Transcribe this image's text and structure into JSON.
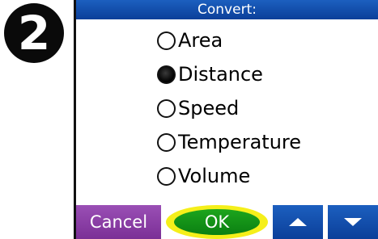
{
  "step_badge": {
    "number": "2"
  },
  "title": "Convert:",
  "options": [
    {
      "label": "Area",
      "selected": false
    },
    {
      "label": "Distance",
      "selected": true
    },
    {
      "label": "Speed",
      "selected": false
    },
    {
      "label": "Temperature",
      "selected": false
    },
    {
      "label": "Volume",
      "selected": false
    }
  ],
  "buttons": {
    "cancel_label": "Cancel",
    "ok_label": "OK",
    "up_icon": "up-arrow-icon",
    "down_icon": "down-arrow-icon"
  },
  "colors": {
    "title_bar": "#1c5fbf",
    "cancel_button": "#8a3fa6",
    "ok_button": "#149a18",
    "ok_highlight": "#f5ef1a",
    "scroll_buttons": "#1c5fbf"
  }
}
